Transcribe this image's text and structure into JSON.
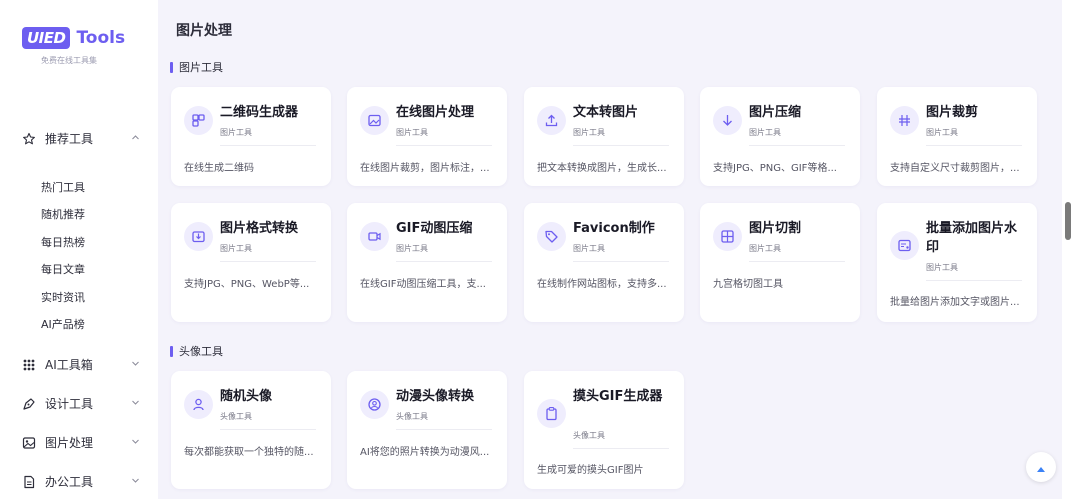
{
  "brand": {
    "logo_box": "UIED",
    "logo_text": "Tools",
    "tagline": "免费在线工具集"
  },
  "sidebar": {
    "groups": [
      {
        "label": "推荐工具",
        "icon": "star-icon",
        "expanded": true
      },
      {
        "label": "AI工具箱",
        "icon": "ai-grid-icon",
        "expanded": false
      },
      {
        "label": "设计工具",
        "icon": "pen-tool-icon",
        "expanded": false
      },
      {
        "label": "图片处理",
        "icon": "image-icon",
        "expanded": false
      },
      {
        "label": "办公工具",
        "icon": "document-icon",
        "expanded": false
      }
    ],
    "sub_items": [
      "热门工具",
      "随机推荐",
      "每日热榜",
      "每日文章",
      "实时资讯",
      "AI产品榜"
    ]
  },
  "page": {
    "title": "图片处理"
  },
  "sections": [
    {
      "title": "图片工具",
      "cards": [
        {
          "name": "二维码生成器",
          "category": "图片工具",
          "desc": "在线生成二维码",
          "icon": "qrcode-icon"
        },
        {
          "name": "在线图片处理",
          "category": "图片工具",
          "desc": "在线图片裁剪，图片标注，...",
          "icon": "image-edit-icon"
        },
        {
          "name": "文本转图片",
          "category": "图片工具",
          "desc": "把文本转换成图片，生成长...",
          "icon": "upload-icon"
        },
        {
          "name": "图片压缩",
          "category": "图片工具",
          "desc": "支持JPG、PNG、GIF等格...",
          "icon": "download-arrow-icon"
        },
        {
          "name": "图片裁剪",
          "category": "图片工具",
          "desc": "支持自定义尺寸裁剪图片，...",
          "icon": "crop-icon"
        },
        {
          "name": "图片格式转换",
          "category": "图片工具",
          "desc": "支持JPG、PNG、WebP等...",
          "icon": "convert-icon"
        },
        {
          "name": "GIF动图压缩",
          "category": "图片工具",
          "desc": "在线GIF动图压缩工具，支...",
          "icon": "video-icon"
        },
        {
          "name": "Favicon制作",
          "category": "图片工具",
          "desc": "在线制作网站图标，支持多...",
          "icon": "tag-icon"
        },
        {
          "name": "图片切割",
          "category": "图片工具",
          "desc": "九宫格切图工具",
          "icon": "grid-icon"
        },
        {
          "name": "批量添加图片水印",
          "category": "图片工具",
          "desc": "批量给图片添加文字或图片...",
          "icon": "watermark-icon"
        }
      ]
    },
    {
      "title": "头像工具",
      "cards": [
        {
          "name": "随机头像",
          "category": "头像工具",
          "desc": "每次都能获取一个独特的随...",
          "icon": "user-icon"
        },
        {
          "name": "动漫头像转换",
          "category": "头像工具",
          "desc": "AI将您的照片转换为动漫风...",
          "icon": "avatar-circle-icon"
        },
        {
          "name": "摸头GIF生成器",
          "category": "头像工具",
          "desc": "生成可爱的摸头GIF图片",
          "icon": "clipboard-icon"
        }
      ]
    }
  ],
  "colors": {
    "accent": "#6d5ef0",
    "background": "#f4f3fb",
    "icon_bg": "#efedfd"
  }
}
